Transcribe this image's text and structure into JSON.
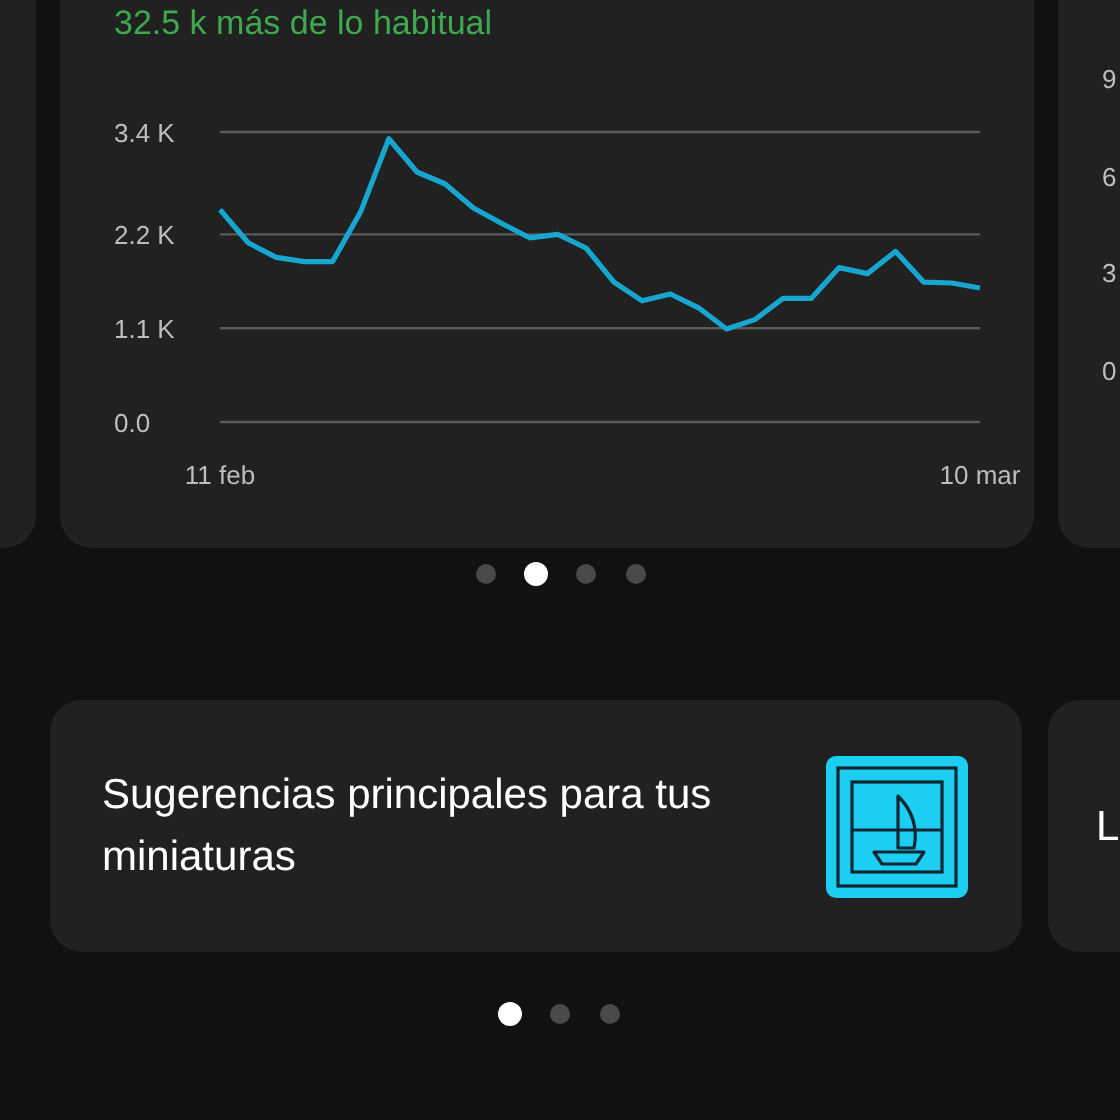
{
  "stats_carousel": {
    "cards": [
      {
        "kind": "side"
      },
      {
        "kind": "chart",
        "subtitle": "32.5 k más de lo habitual",
        "chart_data": {
          "type": "line",
          "categories": [
            "11 feb",
            null,
            null,
            null,
            null,
            null,
            null,
            null,
            null,
            null,
            null,
            null,
            null,
            null,
            null,
            null,
            null,
            null,
            null,
            null,
            null,
            null,
            null,
            null,
            null,
            null,
            null,
            "10 mar"
          ],
          "series": [
            {
              "color": "#16a6cf",
              "values": [
                2.49,
                2.1,
                1.93,
                1.88,
                1.88,
                2.47,
                3.32,
                2.93,
                2.79,
                2.51,
                2.33,
                2.16,
                2.2,
                2.04,
                1.64,
                1.42,
                1.5,
                1.34,
                1.09,
                1.2,
                1.45,
                1.45,
                1.81,
                1.74,
                2.0,
                1.64,
                1.63,
                1.57
              ]
            }
          ],
          "ylim": [
            0,
            3.4
          ],
          "yticks": [
            {
              "value": 0,
              "label": "0.0"
            },
            {
              "value": 1.1,
              "label": "1.1 K"
            },
            {
              "value": 2.2,
              "label": "2.2 K"
            },
            {
              "value": 3.4,
              "label": "3.4 K"
            }
          ]
        }
      },
      {
        "kind": "axis",
        "labels": [
          "9",
          "6",
          "3",
          "0"
        ]
      }
    ],
    "dots": [
      {
        "selected": false
      },
      {
        "selected": true
      },
      {
        "selected": false
      },
      {
        "selected": false
      }
    ]
  },
  "tips_carousel": {
    "cards": [
      {
        "kind": "tip",
        "title": "Sugerencias principales para tus miniaturas"
      },
      {
        "kind": "peek",
        "title": "L"
      }
    ],
    "dots": [
      {
        "selected": true
      },
      {
        "selected": false
      },
      {
        "selected": false
      }
    ]
  }
}
